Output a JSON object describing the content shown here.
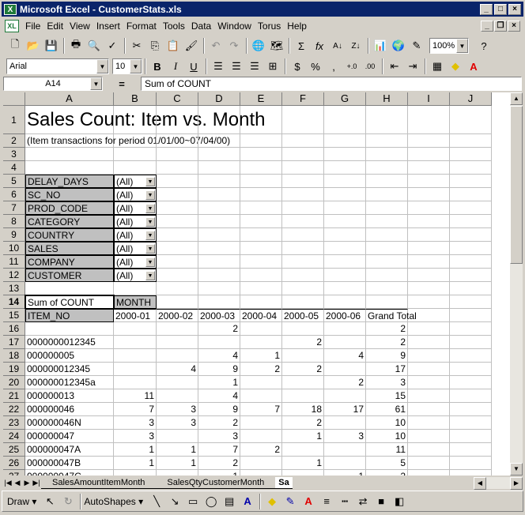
{
  "window": {
    "title": "Microsoft Excel - CustomerStats.xls"
  },
  "menu": [
    "File",
    "Edit",
    "View",
    "Insert",
    "Format",
    "Tools",
    "Data",
    "Window",
    "Torus",
    "Help"
  ],
  "toolbar": {
    "zoom": "100%"
  },
  "format": {
    "font": "Arial",
    "size": "10"
  },
  "formula": {
    "cell": "A14",
    "eq": "=",
    "content": "Sum of COUNT"
  },
  "columns": [
    "A",
    "B",
    "C",
    "D",
    "E",
    "F",
    "G",
    "H",
    "I",
    "J"
  ],
  "sheet": {
    "title": "Sales Count: Item vs. Month",
    "subtitle": "(Item transactions for period 01/01/00~07/04/00)",
    "page_fields": [
      {
        "row": "5",
        "name": "DELAY_DAYS",
        "value": "(All)"
      },
      {
        "row": "6",
        "name": "SC_NO",
        "value": "(All)"
      },
      {
        "row": "7",
        "name": "PROD_CODE",
        "value": "(All)"
      },
      {
        "row": "8",
        "name": "CATEGORY",
        "value": "(All)"
      },
      {
        "row": "9",
        "name": "COUNTRY",
        "value": "(All)"
      },
      {
        "row": "10",
        "name": "SALES",
        "value": "(All)"
      },
      {
        "row": "11",
        "name": "COMPANY",
        "value": "(All)"
      },
      {
        "row": "12",
        "name": "CUSTOMER",
        "value": "(All)"
      }
    ],
    "data_label": "Sum of COUNT",
    "col_field": "MONTH",
    "row_field": "ITEM_NO",
    "months": [
      "2000-01",
      "2000-02",
      "2000-03",
      "2000-04",
      "2000-05",
      "2000-06",
      "Grand Total"
    ],
    "items": [
      {
        "row": "16",
        "id": "",
        "vals": [
          "",
          "",
          "2",
          "",
          "",
          "",
          "2"
        ]
      },
      {
        "row": "17",
        "id": "0000000012345",
        "vals": [
          "",
          "",
          "",
          "",
          "2",
          "",
          "2"
        ]
      },
      {
        "row": "18",
        "id": "000000005",
        "vals": [
          "",
          "",
          "4",
          "1",
          "",
          "4",
          "9"
        ]
      },
      {
        "row": "19",
        "id": "000000012345",
        "vals": [
          "",
          "4",
          "9",
          "2",
          "2",
          "",
          "17"
        ]
      },
      {
        "row": "20",
        "id": "000000012345a",
        "vals": [
          "",
          "",
          "1",
          "",
          "",
          "2",
          "3"
        ]
      },
      {
        "row": "21",
        "id": "000000013",
        "vals": [
          "11",
          "",
          "4",
          "",
          "",
          "",
          "15"
        ]
      },
      {
        "row": "22",
        "id": "000000046",
        "vals": [
          "7",
          "3",
          "9",
          "7",
          "18",
          "17",
          "61"
        ]
      },
      {
        "row": "23",
        "id": "000000046N",
        "vals": [
          "3",
          "3",
          "2",
          "",
          "2",
          "",
          "10"
        ]
      },
      {
        "row": "24",
        "id": "000000047",
        "vals": [
          "3",
          "",
          "3",
          "",
          "1",
          "3",
          "10"
        ]
      },
      {
        "row": "25",
        "id": "000000047A",
        "vals": [
          "1",
          "1",
          "7",
          "2",
          "",
          "",
          "11"
        ]
      },
      {
        "row": "26",
        "id": "000000047B",
        "vals": [
          "1",
          "1",
          "2",
          "",
          "1",
          "",
          "5"
        ]
      },
      {
        "row": "27",
        "id": "000000047C",
        "vals": [
          "",
          "",
          "1",
          "",
          "",
          "1",
          "2"
        ]
      }
    ]
  },
  "tabs": [
    "SalesAmountItemMonth",
    "SalesQtyCustomerMonth",
    "Sa"
  ],
  "drawbar": {
    "draw": "Draw",
    "autoshapes": "AutoShapes"
  }
}
